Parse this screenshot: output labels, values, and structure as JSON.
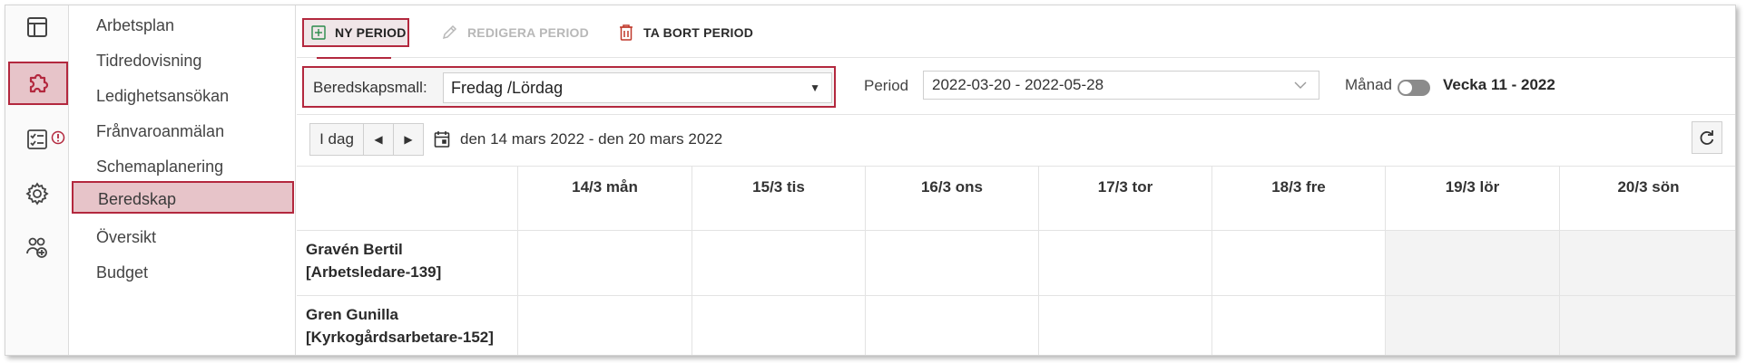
{
  "rail": {
    "items": [
      {
        "icon": "layout-icon"
      },
      {
        "icon": "puzzle-icon",
        "active": true
      },
      {
        "icon": "checklist-icon",
        "badge": "alert-icon"
      },
      {
        "icon": "gear-icon"
      },
      {
        "icon": "users-add-icon"
      }
    ]
  },
  "subnav": {
    "items": [
      {
        "label": "Arbetsplan"
      },
      {
        "label": "Tidredovisning"
      },
      {
        "label": "Ledighetsansökan"
      },
      {
        "label": "Frånvaroanmälan"
      },
      {
        "label": "Schemaplanering"
      },
      {
        "label": "Beredskap",
        "active": true
      },
      {
        "label": "Översikt"
      },
      {
        "label": "Budget"
      }
    ]
  },
  "toolbar": {
    "new_label": "NY PERIOD",
    "edit_label": "REDIGERA PERIOD",
    "delete_label": "TA BORT PERIOD"
  },
  "filters": {
    "template_label": "Beredskapsmall:",
    "template_value": "Fredag /Lördag",
    "period_label": "Period",
    "period_value": "2022-03-20 - 2022-05-28",
    "month_label": "Månad",
    "month_toggle_on": false,
    "week_label": "Vecka 11 - 2022"
  },
  "nav": {
    "today_label": "I dag",
    "range_label": "den 14 mars 2022 - den 20 mars 2022"
  },
  "calendar": {
    "days": [
      {
        "label": "14/3 mån",
        "weekend": false
      },
      {
        "label": "15/3 tis",
        "weekend": false
      },
      {
        "label": "16/3 ons",
        "weekend": false
      },
      {
        "label": "17/3 tor",
        "weekend": false
      },
      {
        "label": "18/3 fre",
        "weekend": false
      },
      {
        "label": "19/3 lör",
        "weekend": true
      },
      {
        "label": "20/3 sön",
        "weekend": true
      }
    ],
    "employees": [
      {
        "name": "Gravén Bertil",
        "role": "[Arbetsledare-139]"
      },
      {
        "name": "Gren Gunilla",
        "role": "[Kyrkogårdsarbetare-152]"
      }
    ]
  },
  "colors": {
    "accent": "#b3283e",
    "highlight": "#e7c4c9",
    "weekend": "#f3f3f3"
  }
}
